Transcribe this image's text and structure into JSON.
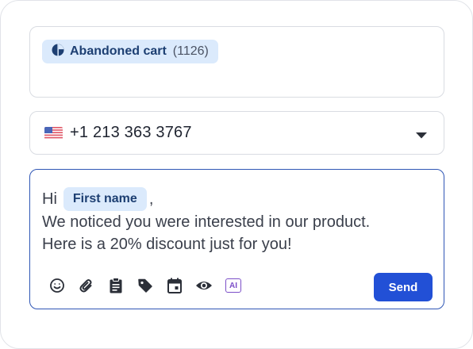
{
  "recipients": {
    "segment": {
      "icon": "pie-chart-icon",
      "label": "Abandoned cart",
      "count": "(1126)"
    }
  },
  "phone": {
    "flag": "us-flag-icon",
    "number": "+1 213 363 3767",
    "dropdown_icon": "caret-down-icon"
  },
  "message": {
    "greeting": "Hi",
    "variable": "First name",
    "after_variable": ",",
    "line2": "We noticed you were interested in our product.",
    "line3": "Here is a 20% discount just for you!"
  },
  "toolbar": {
    "tools": [
      "emoji-icon",
      "attachment-icon",
      "clipboard-icon",
      "tag-icon",
      "calendar-icon",
      "preview-eye-icon",
      "ai-icon"
    ],
    "ai_label": "AI",
    "send_label": "Send"
  },
  "colors": {
    "accent": "#2250d6",
    "chip_bg": "#dbeafc",
    "chip_text": "#1d3f72",
    "focus_border": "#2f56b5",
    "ai": "#7c4fc8"
  }
}
